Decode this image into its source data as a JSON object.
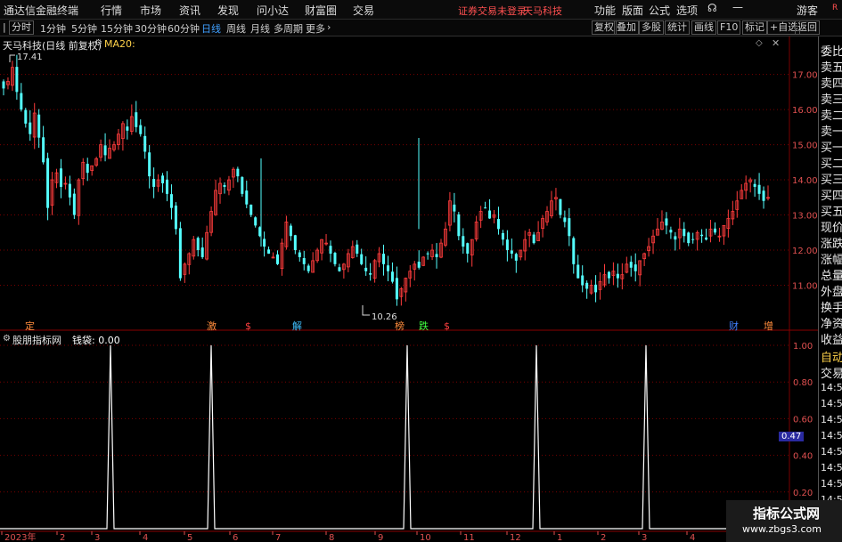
{
  "menubar": {
    "logo_text": "通达信金融终端",
    "items": [
      "行情",
      "市场",
      "资讯",
      "发现",
      "问小达",
      "财富圈",
      "交易"
    ],
    "notice": "证券交易未登录",
    "stock_name": "天马科技",
    "right_items": [
      "功能",
      "版面",
      "公式",
      "选项"
    ],
    "user": "游客",
    "r_badge": "R"
  },
  "toolbar": {
    "periods": [
      "分时",
      "1分钟",
      "5分钟",
      "15分钟",
      "30分钟",
      "60分钟",
      "日线",
      "周线",
      "月线",
      "多周期",
      "更多"
    ],
    "active_period": "日线",
    "right_buttons": [
      "复权",
      "叠加",
      "多股",
      "统计",
      "画线",
      "F10",
      "标记",
      "+自选",
      "返回"
    ]
  },
  "main_chart": {
    "title": "天马科技(日线 前复权)",
    "ma_label": "MA20:",
    "max_label": "17.41",
    "min_label": "10.26",
    "y_ticks": [
      "17.00",
      "16.00",
      "15.00",
      "14.00",
      "13.00",
      "12.00",
      "11.00"
    ],
    "event_markers": [
      {
        "text": "定",
        "color": "#ff8c3c"
      },
      {
        "text": "激",
        "color": "#ff8c3c"
      },
      {
        "text": "$",
        "color": "#ff4040"
      },
      {
        "text": "解",
        "color": "#40c0ff"
      },
      {
        "text": "榜",
        "color": "#ff8c3c"
      },
      {
        "text": "跌",
        "color": "#40ff40"
      },
      {
        "text": "$",
        "color": "#ff4040"
      },
      {
        "text": "财",
        "color": "#4080ff"
      },
      {
        "text": "增",
        "color": "#ff8c3c"
      }
    ]
  },
  "indicator": {
    "title": "股朋指标网",
    "value_label": "钱袋: 0.00",
    "y_ticks": [
      "1.00",
      "0.80",
      "0.60",
      "0.40",
      "0.20"
    ],
    "cursor_value": "0.47"
  },
  "x_axis": {
    "labels": [
      "2023年",
      "2",
      "3",
      "4",
      "5",
      "6",
      "7",
      "8",
      "9",
      "10",
      "11",
      "12",
      "1",
      "2",
      "3",
      "4"
    ]
  },
  "sidebar": {
    "items": [
      "委比",
      "卖五",
      "卖四",
      "卖三",
      "卖二",
      "卖一",
      "买一",
      "买二",
      "买三",
      "买四",
      "买五",
      "现价",
      "涨跌",
      "涨幅",
      "总量",
      "外盘",
      "换手",
      "净资",
      "收益"
    ],
    "lower_items": [
      "自动",
      "交易",
      "14:5",
      "14:5",
      "14:5",
      "14:5",
      "14:5",
      "14:5",
      "14:5",
      "14:5",
      "14:5"
    ]
  },
  "watermark": {
    "line1": "指标公式网",
    "line2": "www.zbgs3.com"
  },
  "colors": {
    "up": "#ff3c3c",
    "down": "#54ffff",
    "grid": "#7a0000",
    "axis_text": "#e05050",
    "white": "#ffffff"
  },
  "chart_data": {
    "type": "candlestick",
    "xlim": [
      0,
      212
    ],
    "ylim": [
      10.0,
      17.8
    ],
    "close_approx": [
      16.6,
      16.8,
      17.2,
      16.5,
      16.0,
      15.6,
      15.3,
      15.9,
      15.2,
      14.5,
      13.2,
      14.0,
      14.2,
      13.8,
      13.9,
      13.5,
      13.0,
      14.0,
      14.5,
      14.2,
      14.4,
      14.6,
      15.0,
      14.7,
      14.9,
      15.0,
      15.3,
      15.6,
      15.4,
      15.8,
      15.5,
      15.3,
      14.8,
      14.1,
      13.8,
      14.0,
      13.9,
      13.6,
      13.2,
      12.6,
      11.2,
      11.6,
      11.9,
      12.3,
      12.0,
      11.8,
      12.5,
      13.1,
      13.7,
      13.9,
      13.8,
      14.0,
      14.3,
      14.1,
      13.6,
      13.3,
      13.0,
      12.7,
      12.4,
      12.1,
      11.9,
      11.8,
      11.6,
      12.2,
      12.8,
      12.4,
      12.0,
      11.8,
      11.6,
      11.4,
      11.7,
      12.0,
      12.3,
      12.2,
      11.9,
      11.6,
      11.4,
      11.6,
      11.9,
      12.1,
      11.9,
      11.6,
      11.4,
      11.3,
      11.7,
      11.9,
      11.6,
      11.4,
      11.1,
      10.6,
      10.9,
      11.2,
      11.4,
      11.6,
      11.5,
      11.8,
      11.9,
      12.0,
      11.8,
      12.2,
      12.6,
      13.4,
      13.1,
      12.4,
      12.1,
      11.9,
      12.3,
      12.8,
      13.1,
      13.2,
      12.9,
      13.0,
      12.6,
      12.3,
      12.0,
      11.9,
      11.7,
      12.0,
      12.3,
      12.5,
      12.2,
      12.5,
      12.9,
      13.1,
      13.4,
      13.5,
      13.0,
      12.8,
      12.4,
      11.6,
      11.2,
      11.0,
      10.9,
      11.0,
      10.8,
      11.1,
      11.3,
      11.2,
      11.4,
      11.2,
      11.3,
      11.6,
      11.5,
      11.4,
      11.7,
      11.9,
      12.1,
      12.4,
      12.6,
      12.8,
      12.7,
      12.5,
      12.3,
      12.6,
      12.4,
      12.2,
      12.3,
      12.5,
      12.4,
      12.3,
      12.6,
      12.5,
      12.4,
      12.7,
      12.9,
      13.1,
      13.4,
      13.7,
      13.9,
      14.0,
      13.8,
      13.6,
      13.4,
      13.5
    ],
    "indicator_series": {
      "name": "钱袋",
      "spike_value": 1.0,
      "base_value": 0.0,
      "spike_dates_approx": [
        "2023-03",
        "2023-05",
        "2023-09",
        "2024-02",
        "2024-03"
      ]
    }
  }
}
